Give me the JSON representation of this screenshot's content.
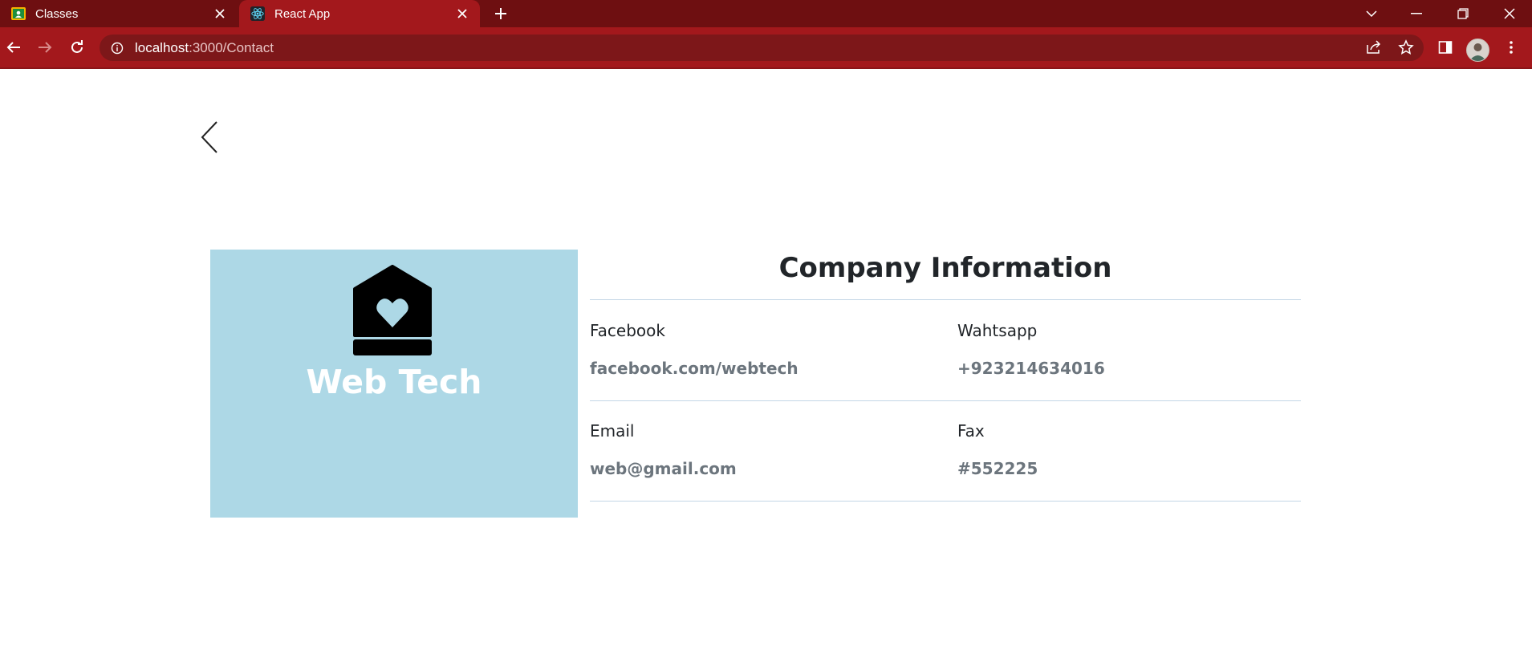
{
  "browser": {
    "tabs": [
      {
        "title": "Classes",
        "icon": "google-classroom-icon",
        "active": false
      },
      {
        "title": "React App",
        "icon": "react-icon",
        "active": true
      }
    ],
    "url_host": "localhost",
    "url_path": ":3000/Contact"
  },
  "colors": {
    "tabbar": "#6e0f11",
    "toolbar": "#a3181c",
    "brand_panel": "#add8e6",
    "heading": "#212529",
    "muted_value": "#6c757d"
  },
  "brand": {
    "name": "Web Tech",
    "icon": "house-heart-icon"
  },
  "company": {
    "title": "Company Information",
    "fields": [
      {
        "label": "Facebook",
        "value": "facebook.com/webtech"
      },
      {
        "label": "Wahtsapp",
        "value": "+923214634016"
      },
      {
        "label": "Email",
        "value": "web@gmail.com"
      },
      {
        "label": "Fax",
        "value": "#552225"
      }
    ]
  }
}
